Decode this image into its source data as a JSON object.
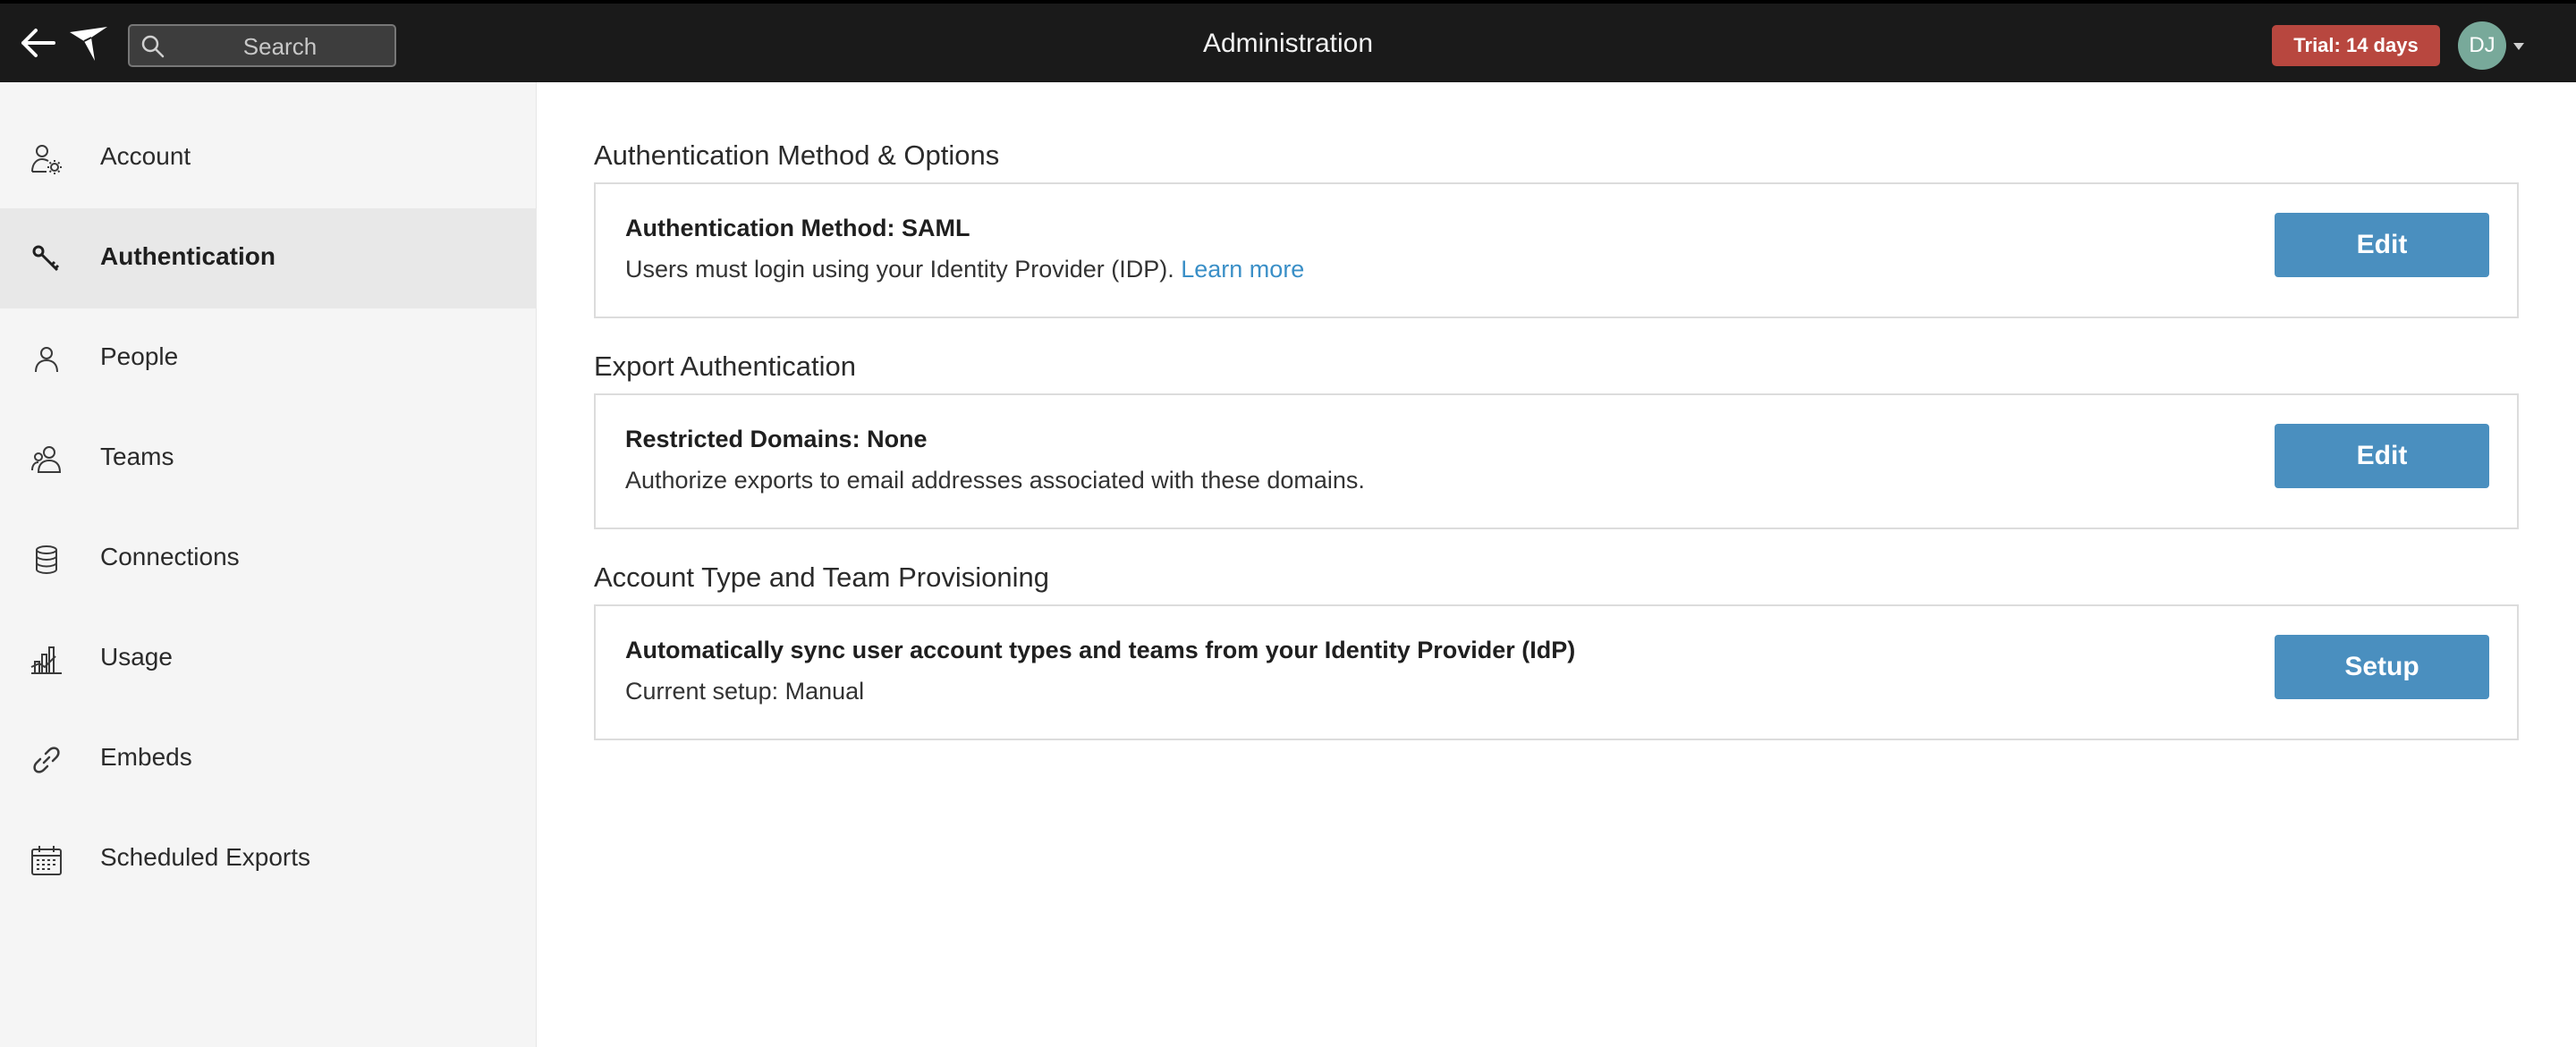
{
  "header": {
    "title": "Administration",
    "search_placeholder": "Search",
    "trial_badge": "Trial: 14 days",
    "avatar_initials": "DJ"
  },
  "sidebar": {
    "items": [
      {
        "label": "Account",
        "icon": "user-gear-icon",
        "active": false
      },
      {
        "label": "Authentication",
        "icon": "key-icon",
        "active": true
      },
      {
        "label": "People",
        "icon": "person-icon",
        "active": false
      },
      {
        "label": "Teams",
        "icon": "group-icon",
        "active": false
      },
      {
        "label": "Connections",
        "icon": "database-icon",
        "active": false
      },
      {
        "label": "Usage",
        "icon": "bar-chart-icon",
        "active": false
      },
      {
        "label": "Embeds",
        "icon": "link-icon",
        "active": false
      },
      {
        "label": "Scheduled Exports",
        "icon": "calendar-icon",
        "active": false
      }
    ]
  },
  "main": {
    "sections": [
      {
        "heading": "Authentication Method & Options",
        "card_title": "Authentication Method: SAML",
        "card_desc": "Users must login using your Identity Provider (IDP).",
        "link_text": "Learn more",
        "button_label": "Edit"
      },
      {
        "heading": "Export Authentication",
        "card_title": "Restricted Domains: None",
        "card_desc": "Authorize exports to email addresses associated with these domains.",
        "button_label": "Edit"
      },
      {
        "heading": "Account Type and Team Provisioning",
        "card_title": "Automatically sync user account types and teams from your Identity Provider (IdP)",
        "card_desc": "Current setup: Manual",
        "button_label": "Setup"
      }
    ]
  },
  "colors": {
    "topbar": "#1a1a1a",
    "trial_badge": "#b8473f",
    "avatar": "#78a99a",
    "button": "#4a8fbf",
    "link": "#3a8fc7",
    "sidebar_bg": "#f5f5f5",
    "sidebar_active": "#e8e8e8"
  }
}
